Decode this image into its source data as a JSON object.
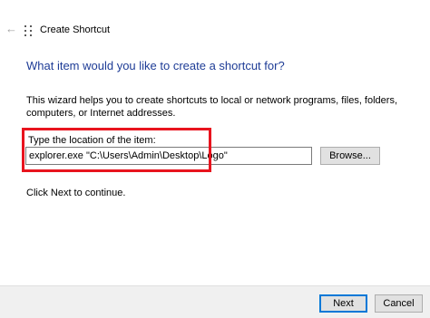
{
  "titlebar": {
    "back_icon": "back-arrow-icon",
    "app_icon": "wizard-icon",
    "title": "Create Shortcut"
  },
  "main": {
    "heading": "What item would you like to create a shortcut for?",
    "description": "This wizard helps you to create shortcuts to local or network programs, files, folders, computers, or Internet addresses.",
    "location_label": "Type the location of the item:",
    "location_value": "explorer.exe \"C:\\Users\\Admin\\Desktop\\Logo\"",
    "browse_label": "Browse...",
    "continue_text": "Click Next to continue."
  },
  "footer": {
    "next_label": "Next",
    "cancel_label": "Cancel"
  },
  "colors": {
    "heading": "#1e3c96",
    "highlight": "#e8141e",
    "default_button_border": "#0078d7",
    "footer_bg": "#f0f0f0"
  }
}
